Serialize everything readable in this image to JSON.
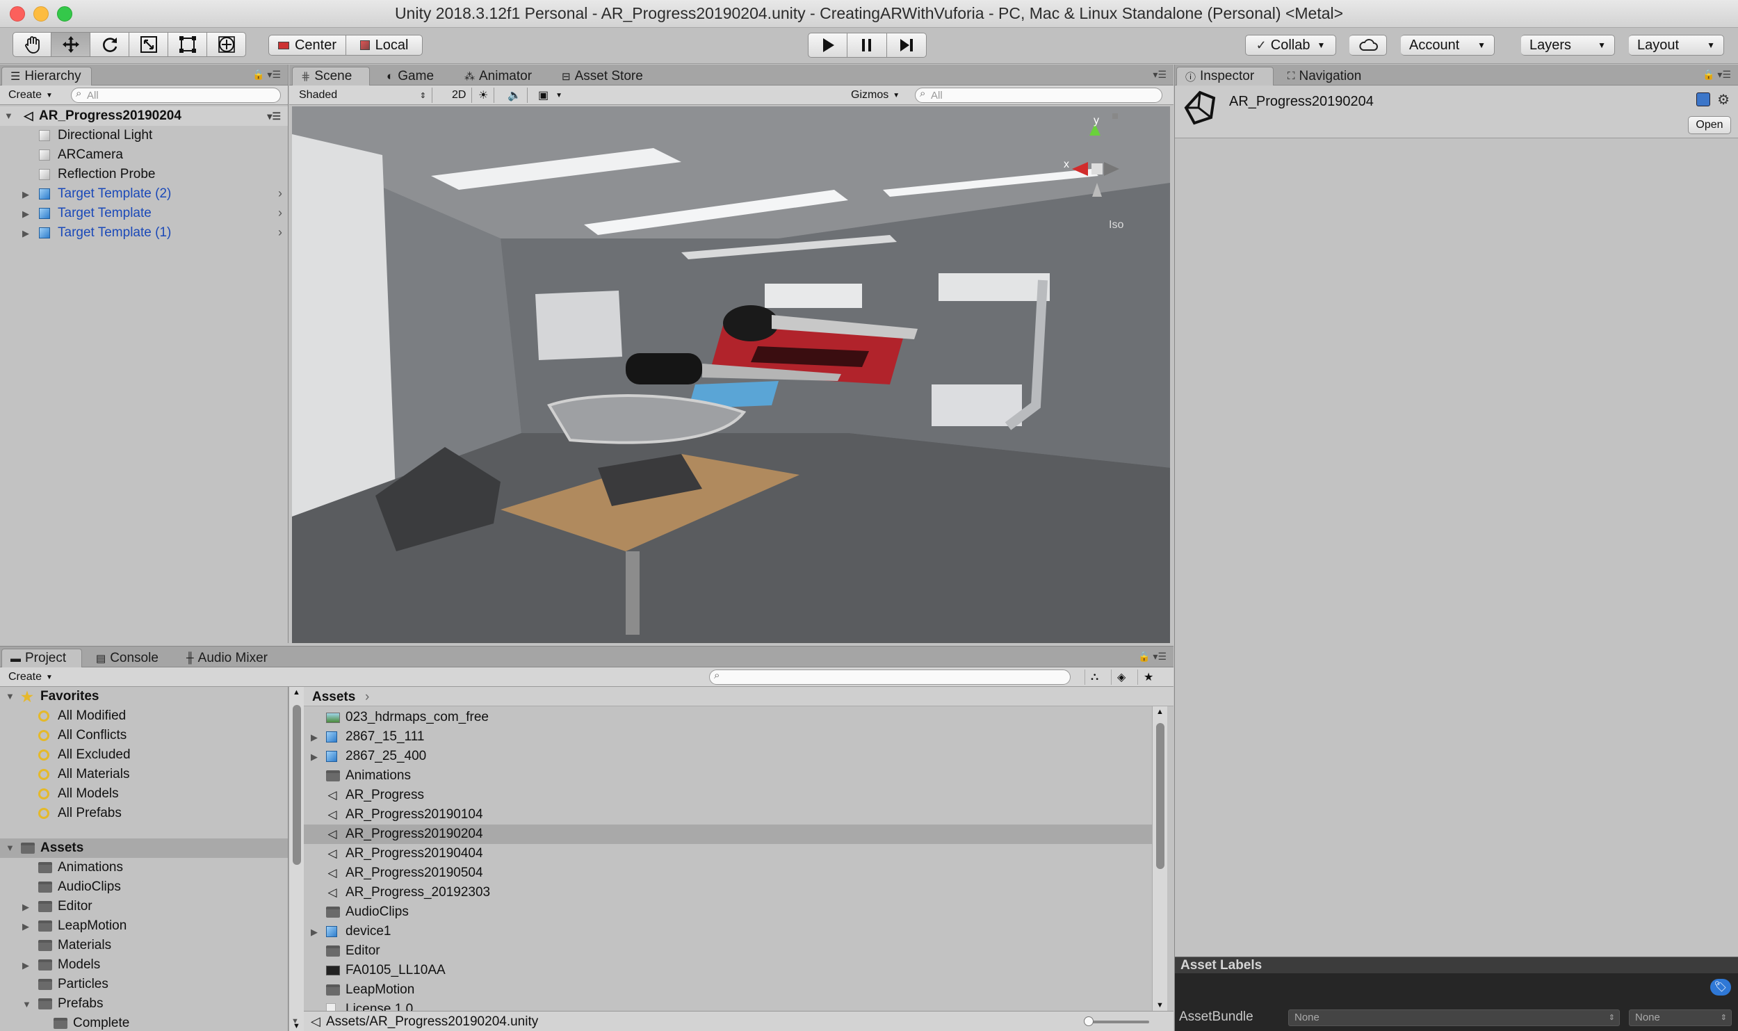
{
  "window": {
    "title": "Unity 2018.3.12f1 Personal - AR_Progress20190204.unity - CreatingARWithVuforia - PC, Mac & Linux Standalone (Personal) <Metal>",
    "colors": {
      "close": "#fc605c",
      "minimize": "#fdbc40",
      "zoom": "#34c84a"
    }
  },
  "toolbar": {
    "tools": [
      "hand-icon",
      "move-icon",
      "rotate-icon",
      "scale-icon",
      "rect-icon",
      "transform-icon"
    ],
    "pivot": "Center",
    "space": "Local",
    "collab": "Collab",
    "account": "Account",
    "layers": "Layers",
    "layout": "Layout"
  },
  "hierarchy": {
    "tab": "Hierarchy",
    "create": "Create",
    "search_placeholder": "All",
    "scene": "AR_Progress20190204",
    "items": [
      {
        "label": "Directional Light",
        "type": "go"
      },
      {
        "label": "ARCamera",
        "type": "go"
      },
      {
        "label": "Reflection Probe",
        "type": "go"
      },
      {
        "label": "Target Template (2)",
        "type": "prefab"
      },
      {
        "label": "Target Template",
        "type": "prefab"
      },
      {
        "label": "Target Template (1)",
        "type": "prefab"
      }
    ]
  },
  "scene": {
    "tabs": [
      "Scene",
      "Game",
      "Animator",
      "Asset Store"
    ],
    "shading": "Shaded",
    "mode_2d": "2D",
    "gizmos": "Gizmos",
    "search_placeholder": "All",
    "gizmo_axes": {
      "y": "y",
      "x": "x",
      "persp": "Iso"
    }
  },
  "inspector": {
    "tabs": [
      "Inspector",
      "Navigation"
    ],
    "asset_name": "AR_Progress20190204",
    "open": "Open",
    "asset_labels": "Asset Labels",
    "asset_bundle": "AssetBundle",
    "bundle_value": "None",
    "variant_value": "None"
  },
  "project": {
    "tabs": [
      "Project",
      "Console",
      "Audio Mixer"
    ],
    "create": "Create",
    "favorites": {
      "label": "Favorites",
      "items": [
        "All Modified",
        "All Conflicts",
        "All Excluded",
        "All Materials",
        "All Models",
        "All Prefabs"
      ]
    },
    "assets_root": {
      "label": "Assets",
      "items": [
        {
          "label": "Animations",
          "expandable": false
        },
        {
          "label": "AudioClips",
          "expandable": false
        },
        {
          "label": "Editor",
          "expandable": true
        },
        {
          "label": "LeapMotion",
          "expandable": true
        },
        {
          "label": "Materials",
          "expandable": false
        },
        {
          "label": "Models",
          "expandable": true
        },
        {
          "label": "Particles",
          "expandable": false
        },
        {
          "label": "Prefabs",
          "expandable": true,
          "open": true
        },
        {
          "label": "Complete",
          "expandable": false,
          "indent": 2
        }
      ]
    },
    "breadcrumb": "Assets",
    "files": [
      {
        "label": "023_hdrmaps_com_free",
        "icon": "image",
        "expandable": false
      },
      {
        "label": "2867_15_111",
        "icon": "prefab",
        "expandable": true
      },
      {
        "label": "2867_25_400",
        "icon": "prefab",
        "expandable": true
      },
      {
        "label": "Animations",
        "icon": "folder",
        "expandable": false
      },
      {
        "label": "AR_Progress",
        "icon": "unity",
        "expandable": false
      },
      {
        "label": "AR_Progress20190104",
        "icon": "unity",
        "expandable": false
      },
      {
        "label": "AR_Progress20190204",
        "icon": "unity",
        "expandable": false,
        "selected": true
      },
      {
        "label": "AR_Progress20190404",
        "icon": "unity",
        "expandable": false
      },
      {
        "label": "AR_Progress20190504",
        "icon": "unity",
        "expandable": false
      },
      {
        "label": "AR_Progress_20192303",
        "icon": "unity",
        "expandable": false
      },
      {
        "label": "AudioClips",
        "icon": "folder",
        "expandable": false
      },
      {
        "label": "device1",
        "icon": "prefab",
        "expandable": true
      },
      {
        "label": "Editor",
        "icon": "folder",
        "expandable": false
      },
      {
        "label": "FA0105_LL10AA",
        "icon": "dark",
        "expandable": false
      },
      {
        "label": "LeapMotion",
        "icon": "folder",
        "expandable": false
      },
      {
        "label": "License 1.0",
        "icon": "doc",
        "expandable": false
      }
    ],
    "status_path": "Assets/AR_Progress20190204.unity"
  }
}
